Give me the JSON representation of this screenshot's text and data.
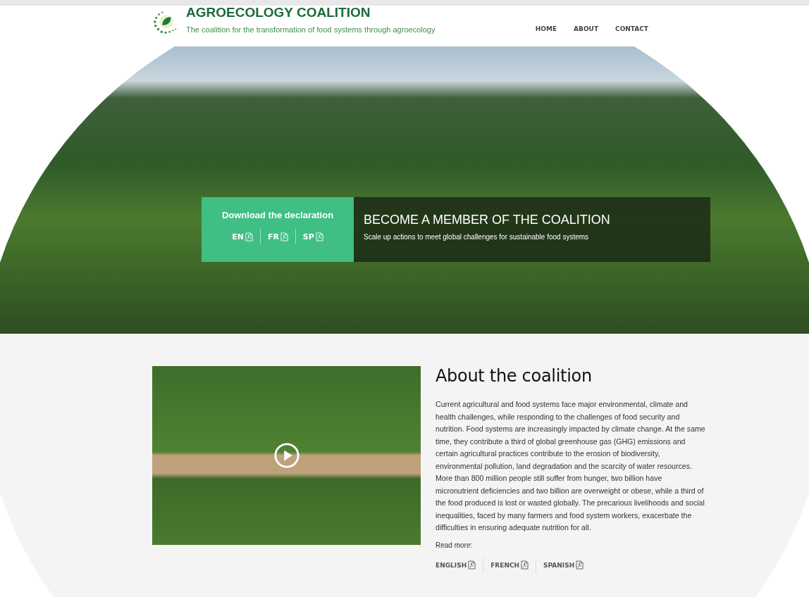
{
  "header": {
    "logo_title": "AGROECOLOGY COALITION",
    "tagline": "The coalition for the transformation of food systems through agroecology",
    "nav": [
      {
        "label": "HOME"
      },
      {
        "label": "ABOUT"
      },
      {
        "label": "CONTACT"
      }
    ]
  },
  "hero": {
    "declaration": {
      "title": "Download the declaration",
      "links": [
        {
          "label": "EN"
        },
        {
          "label": "FR"
        },
        {
          "label": "SP"
        }
      ]
    },
    "cta": {
      "title": "BECOME A MEMBER OF THE COALITION",
      "subtitle": "Scale up actions to meet global challenges for sustainable food systems"
    }
  },
  "about": {
    "title": "About the coalition",
    "paragraph": "Current agricultural and food systems face major environmental, climate and health challenges, while responding to the challenges of food security and nutrition. Food systems are increasingly impacted by climate change. At the same time, they contribute a third of global greenhouse gas (GHG) emissions and certain agricultural practices contribute to the erosion of biodiversity, environmental pollution, land degradation and the scarcity of water resources. More than 800 million people still suffer from hunger, two billion have micronutrient deficiencies and two billion are overweight or obese, while a third of the food produced is lost or wasted globally. The precarious livelihoods and social inequalities, faced by many farmers and food system workers, exacerbate the difficulties in ensuring adequate nutrition for all.",
    "read_more": "Read more:",
    "links": [
      {
        "label": "ENGLISH"
      },
      {
        "label": "FRENCH"
      },
      {
        "label": "SPANISH"
      }
    ]
  }
}
